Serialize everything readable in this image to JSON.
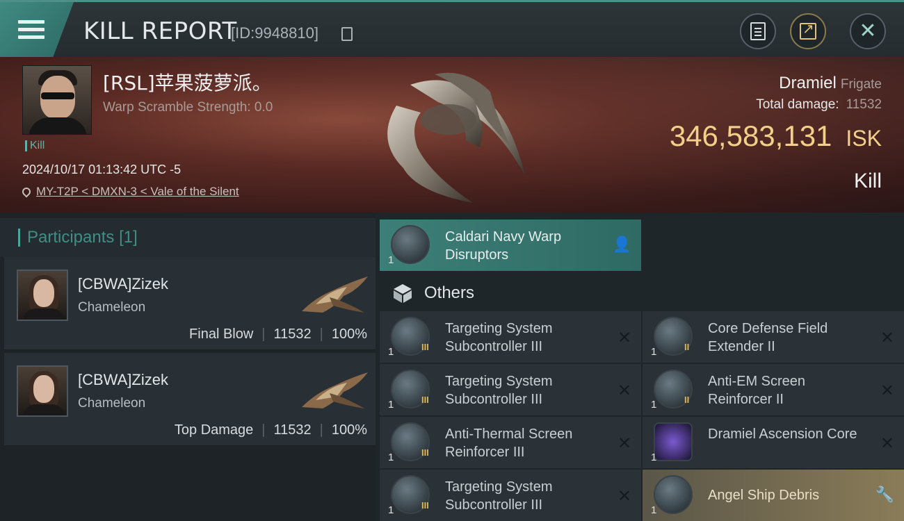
{
  "header": {
    "title": "KILL REPORT",
    "report_id": "[ID:9948810]"
  },
  "victim": {
    "name": "[RSL]苹果菠萝派。",
    "warp_strength": "Warp Scramble Strength: 0.0",
    "tag": "Kill",
    "datetime": "2024/10/17 01:13:42 UTC -5",
    "location": "MY-T2P < DMXN-3 < Vale of the Silent"
  },
  "ship": {
    "name": "Dramiel",
    "class": "Frigate",
    "total_damage_label": "Total damage:",
    "total_damage": "11532",
    "isk_value": "346,583,131",
    "isk_unit": "ISK",
    "result": "Kill"
  },
  "participants": {
    "title": "Participants",
    "count": "[1]",
    "list": [
      {
        "name": "[CBWA]Zizek",
        "ship": "Chameleon",
        "role": "Final Blow",
        "damage": "11532",
        "percent": "100%"
      },
      {
        "name": "[CBWA]Zizek",
        "ship": "Chameleon",
        "role": "Top Damage",
        "damage": "11532",
        "percent": "100%"
      }
    ]
  },
  "items": {
    "highlighted": {
      "label": "Caldari Navy Warp Disruptors",
      "qty": "1"
    },
    "others_title": "Others",
    "list": [
      {
        "label": "Targeting System Subcontroller III",
        "qty": "1",
        "tier": "III"
      },
      {
        "label": "Core Defense Field Extender II",
        "qty": "1",
        "tier": "II"
      },
      {
        "label": "Targeting System Subcontroller III",
        "qty": "1",
        "tier": "III"
      },
      {
        "label": "Anti-EM Screen Reinforcer II",
        "qty": "1",
        "tier": "II"
      },
      {
        "label": "Anti-Thermal Screen Reinforcer III",
        "qty": "1",
        "tier": "III"
      },
      {
        "label": "Dramiel Ascension Core",
        "qty": "1",
        "tier": ""
      },
      {
        "label": "Targeting System Subcontroller III",
        "qty": "1",
        "tier": "III"
      },
      {
        "label": "Angel Ship Debris",
        "qty": "1",
        "tier": ""
      }
    ]
  },
  "colors": {
    "accent_teal": "#3f8a82",
    "isk_gold": "#f2d08a",
    "banner_red": "#5a2a24"
  },
  "icons": [
    "menu-icon",
    "copy-icon",
    "clipboard-icon",
    "share-icon",
    "close-icon",
    "location-pin-icon",
    "cube-icon",
    "close-x-icon",
    "person-icon",
    "wrench-icon"
  ]
}
